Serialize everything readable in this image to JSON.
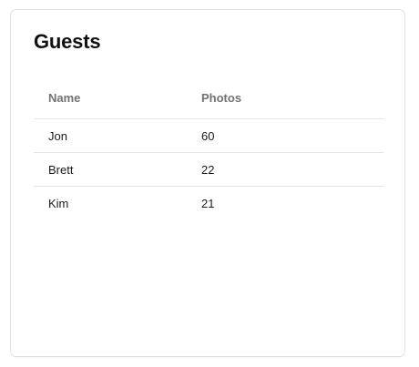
{
  "card": {
    "title": "Guests"
  },
  "table": {
    "columns": [
      "Name",
      "Photos"
    ],
    "rows": [
      {
        "name": "Jon",
        "photos": "60"
      },
      {
        "name": "Brett",
        "photos": "22"
      },
      {
        "name": "Kim",
        "photos": "21"
      }
    ]
  },
  "colors": {
    "header_text": "#727272",
    "body_text": "#1a1a1a",
    "divider": "#e4e4e4",
    "card_border": "#e1e1e1"
  }
}
